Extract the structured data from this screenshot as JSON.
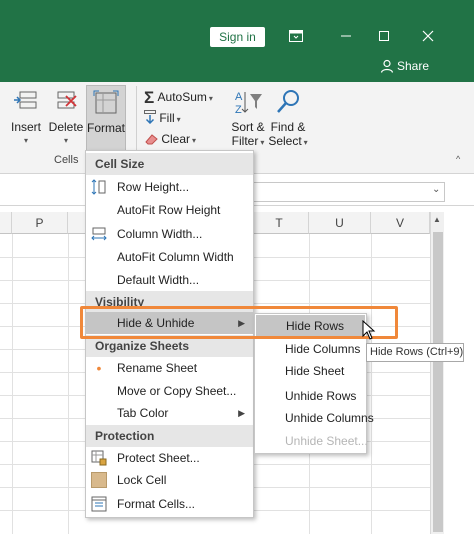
{
  "titlebar": {
    "signin_label": "Sign in",
    "share_label": "Share",
    "buttons": [
      "restore-ribbon-icon",
      "minimize-icon",
      "maximize-icon",
      "close-icon"
    ],
    "accent_color": "#217346"
  },
  "ribbon": {
    "cells_group": {
      "label": "Cells",
      "insert_label": "Insert",
      "delete_label": "Delete",
      "format_label": "Format"
    },
    "editing_group": {
      "autosum_label": "AutoSum",
      "fill_label": "Fill",
      "clear_label": "Clear",
      "sort_filter_label_1": "Sort &",
      "sort_filter_label_2": "Filter",
      "find_select_label_1": "Find &",
      "find_select_label_2": "Select"
    }
  },
  "grid": {
    "columns": [
      "P",
      "T",
      "U",
      "V"
    ]
  },
  "format_menu": {
    "cell_size_header": "Cell Size",
    "row_height": "Row Height...",
    "autofit_row_height": "AutoFit Row Height",
    "column_width": "Column Width...",
    "autofit_column_width": "AutoFit Column Width",
    "default_width": "Default Width...",
    "visibility_header": "Visibility",
    "hide_unhide": "Hide & Unhide",
    "organize_header": "Organize Sheets",
    "rename_sheet": "Rename Sheet",
    "move_copy_sheet": "Move or Copy Sheet...",
    "tab_color": "Tab Color",
    "protection_header": "Protection",
    "protect_sheet": "Protect Sheet...",
    "lock_cell": "Lock Cell",
    "format_cells": "Format Cells..."
  },
  "submenu": {
    "hide_rows": "Hide Rows",
    "hide_columns": "Hide Columns",
    "hide_sheet": "Hide Sheet",
    "unhide_rows": "Unhide Rows",
    "unhide_columns": "Unhide Columns",
    "unhide_sheet": "Unhide Sheet..."
  },
  "tooltip": "Hide Rows (Ctrl+9)",
  "highlight_color": "#f0883a"
}
